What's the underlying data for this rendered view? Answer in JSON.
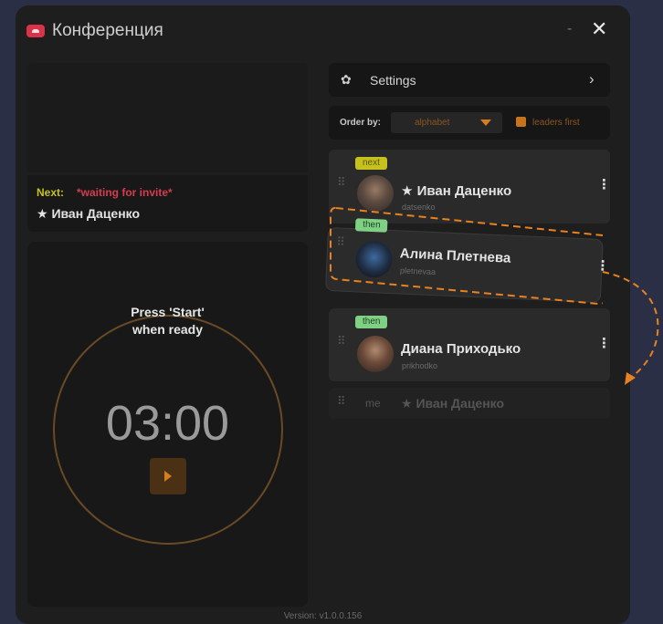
{
  "window": {
    "title": "Конференция",
    "minimize": "-",
    "close": "✕"
  },
  "next_up": {
    "label": "Next:",
    "status": "*waiting for invite*",
    "name": "★ Иван Даценко"
  },
  "timer": {
    "prompt_line1": "Press 'Start'",
    "prompt_line2": "when ready",
    "time": "03:00"
  },
  "version": "Version: v1.0.0.156",
  "settings": {
    "label": "Settings",
    "icon": "gear-icon",
    "chevron": "›"
  },
  "order": {
    "label": "Order by:",
    "selected": "alphabet",
    "leaders_first_label": "leaders first",
    "leaders_first_checked": true
  },
  "participants": [
    {
      "tag": "next",
      "name": "★ Иван Даценко",
      "login": "datsenko"
    },
    {
      "tag": "then",
      "name": "Алина Плетнева",
      "login": "pletnevaa"
    },
    {
      "tag": "then",
      "name": "Диана Приходько",
      "login": "prikhodko"
    }
  ],
  "me_row": {
    "label": "me",
    "name": "★ Иван Даценко"
  },
  "colors": {
    "accent": "#d67d1f",
    "next_tag": "#c6c21d",
    "then_tag": "#7fcf85",
    "app_icon": "#d9334a"
  }
}
